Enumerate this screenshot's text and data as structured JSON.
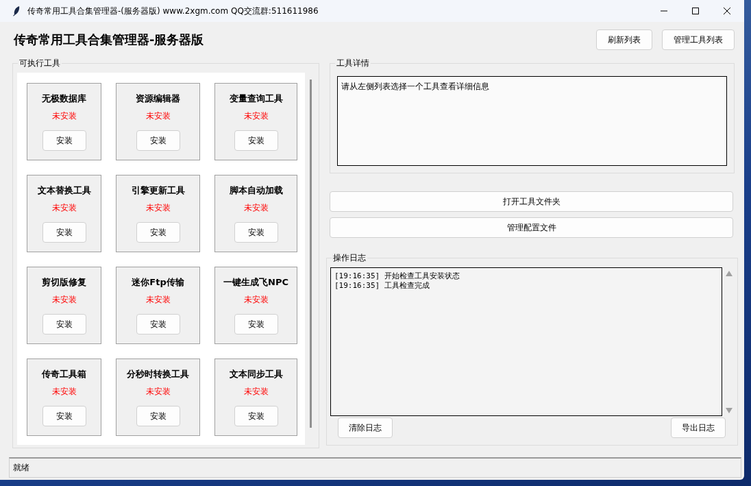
{
  "window": {
    "title": "传奇常用工具合集管理器-(服务器版)  www.2xgm.com  QQ交流群:511611986"
  },
  "header": {
    "title": "传奇常用工具合集管理器-服务器版",
    "buttons": [
      "刷新列表",
      "管理工具列表"
    ]
  },
  "tools_panel": {
    "label": "可执行工具",
    "tools": [
      {
        "name": "无极数据库",
        "status": "未安装",
        "installed": false,
        "button": "安装"
      },
      {
        "name": "资源编辑器",
        "status": "未安装",
        "installed": false,
        "button": "安装"
      },
      {
        "name": "变量查询工具",
        "status": "未安装",
        "installed": false,
        "button": "安装"
      },
      {
        "name": "文本替换工具",
        "status": "未安装",
        "installed": false,
        "button": "安装"
      },
      {
        "name": "引擎更新工具",
        "status": "未安装",
        "installed": false,
        "button": "安装"
      },
      {
        "name": "脚本自动加载",
        "status": "未安装",
        "installed": false,
        "button": "安装"
      },
      {
        "name": "剪切版修复",
        "status": "未安装",
        "installed": false,
        "button": "安装"
      },
      {
        "name": "迷你Ftp传输",
        "status": "未安装",
        "installed": false,
        "button": "安装"
      },
      {
        "name": "一键生成飞NPC",
        "status": "未安装",
        "installed": false,
        "button": "安装"
      },
      {
        "name": "传奇工具箱",
        "status": "未安装",
        "installed": false,
        "button": "安装"
      },
      {
        "name": "分秒时转换工具",
        "status": "未安装",
        "installed": false,
        "button": "安装"
      },
      {
        "name": "文本同步工具",
        "status": "未安装",
        "installed": false,
        "button": "安装"
      }
    ]
  },
  "details": {
    "label": "工具详情",
    "text": "请从左侧列表选择一个工具查看详细信息"
  },
  "actions": [
    "打开工具文件夹",
    "管理配置文件"
  ],
  "log": {
    "label": "操作日志",
    "lines": [
      "[19:16:35] 开始检查工具安装状态",
      "[19:16:35] 工具检查完成"
    ],
    "buttons": [
      "清除日志",
      "导出日志"
    ]
  },
  "status_bar": {
    "text": "就绪"
  }
}
